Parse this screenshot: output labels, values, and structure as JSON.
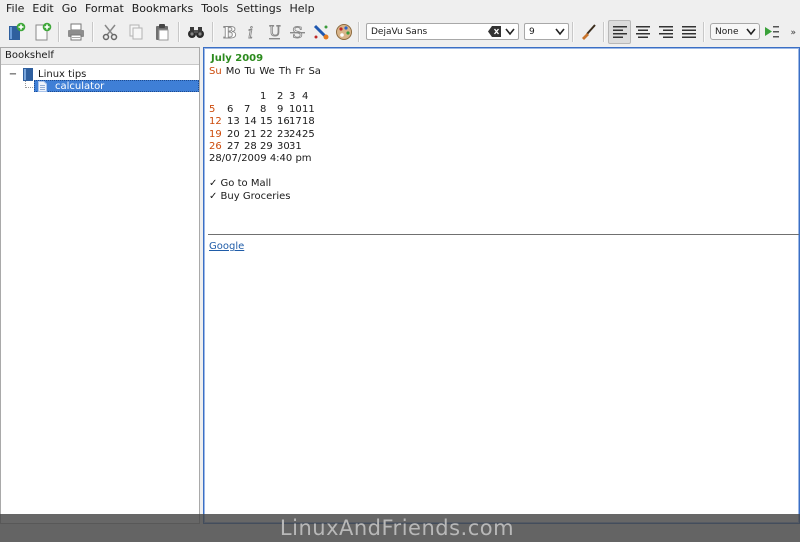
{
  "menu": {
    "items": [
      {
        "label": "File"
      },
      {
        "label": "Edit"
      },
      {
        "label": "Go"
      },
      {
        "label": "Format"
      },
      {
        "label": "Bookmarks"
      },
      {
        "label": "Tools"
      },
      {
        "label": "Settings"
      },
      {
        "label": "Help"
      }
    ]
  },
  "toolbar": {
    "font_name": "DejaVu Sans",
    "font_size": "9",
    "heading_style": "None",
    "overflow_glyph": "»"
  },
  "bookshelf": {
    "header": "Bookshelf",
    "book": {
      "toggle": "−",
      "label": "Linux tips"
    },
    "page": {
      "label": "calculator"
    }
  },
  "editor": {
    "calendar": {
      "title": "July 2009",
      "day_names": [
        "Su",
        "Mo",
        "Tu",
        "We",
        "Th",
        "Fr",
        "Sa"
      ],
      "weeks": [
        [
          "",
          "",
          "",
          "1",
          "2",
          "3",
          "4"
        ],
        [
          "5",
          "6",
          "7",
          "8",
          "9",
          "10",
          "11"
        ],
        [
          "12",
          "13",
          "14",
          "15",
          "16",
          "17",
          "18"
        ],
        [
          "19",
          "20",
          "21",
          "22",
          "23",
          "24",
          "25"
        ],
        [
          "26",
          "27",
          "28",
          "29",
          "30",
          "31",
          ""
        ]
      ]
    },
    "timestamp": "28/07/2009 4:40 pm",
    "todos": [
      "✓ Go to Mall",
      "✓ Buy Groceries"
    ],
    "link_text": "Google"
  },
  "watermark": "LinuxAndFriends.com",
  "colors": {
    "calendar_title": "#2b8a1d",
    "sunday": "#cc4a0a",
    "selection": "#3f7fd6",
    "link": "#1f5ca8",
    "editor_border": "#3b6fc4"
  }
}
